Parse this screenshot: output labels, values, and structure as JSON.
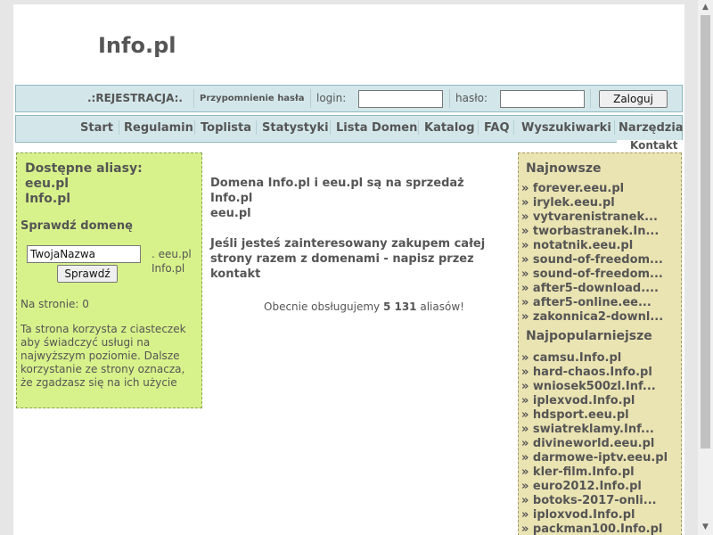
{
  "header": {
    "logo": "Info.pl"
  },
  "loginbar": {
    "register": ".:REJESTRACJA:.",
    "remind": "Przypomnienie hasła",
    "login_label": "login:",
    "password_label": "hasło:",
    "login_value": "",
    "password_value": "",
    "submit": "Zaloguj"
  },
  "nav": {
    "items": [
      "Start",
      "Regulamin",
      "Toplista",
      "Statystyki",
      "Lista Domen",
      "Katalog",
      "FAQ",
      "Wyszukiwarki",
      "Narzędzia",
      "Kontakt"
    ]
  },
  "left": {
    "aliases_heading": "Dostępne aliasy:",
    "alias1": "eeu.pl",
    "alias2": "Info.pl",
    "check_heading": "Sprawdź domenę",
    "domain_value": "TwojaNazwa",
    "domain_opt1": ". eeu.pl",
    "domain_opt2": "Info.pl",
    "check_button": "Sprawdź",
    "on_page": "Na stronie: 0",
    "cookie_text": "Ta strona korzysta z ciasteczek aby świadczyć usługi na najwyższym poziomie. Dalsze korzystanie ze strony oznacza, że zgadzasz się na ich użycie"
  },
  "main": {
    "sale_line1": "Domena Info.pl i eeu.pl są na sprzedaż",
    "sale_line2": "Info.pl",
    "sale_line3": "eeu.pl",
    "contact_text": "Jeśli jesteś zainteresowany zakupem całej strony razem z domenami - napisz przez kontakt",
    "stats_prefix": "Obecnie obsługujemy ",
    "stats_count": "5 131",
    "stats_suffix": " aliasów!"
  },
  "right": {
    "newest_heading": "Najnowsze",
    "newest": [
      "» forever.eeu.pl",
      "» irylek.eeu.pl",
      "» vytvarenistranek...",
      "» tworbastranek.In...",
      "» notatnik.eeu.pl",
      "» sound-of-freedom...",
      "» sound-of-freedom...",
      "» after5-download....",
      "» after5-online.ee...",
      "» zakonnica2-downl..."
    ],
    "popular_heading": "Najpopularniejsze",
    "popular": [
      "» camsu.Info.pl",
      "» hard-chaos.Info.pl",
      "» wniosek500zl.Inf...",
      "» iplexvod.Info.pl",
      "» hdsport.eeu.pl",
      "» swiatreklamy.Inf...",
      "» divineworld.eeu.pl",
      "» darmowe-iptv.eeu.pl",
      "» kler-film.Info.pl",
      "» euro2012.Info.pl",
      "» botoks-2017-onli...",
      "» iploxvod.Info.pl",
      "» packman100.Info.pl"
    ]
  },
  "colors": {
    "login_bar_bg": "#d3e7ea",
    "left_box_bg": "#d8f28b",
    "right_box_bg": "#eae3b2",
    "text": "#555555"
  }
}
